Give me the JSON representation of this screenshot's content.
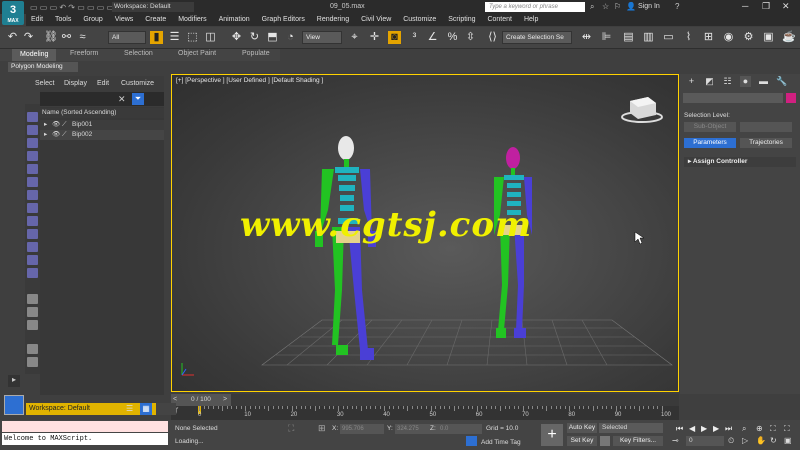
{
  "app": {
    "title": "09_05.max",
    "workspace": "Workspace: Default",
    "search_placeholder": "Type a keyword or phrase",
    "signin": "Sign In"
  },
  "menu": [
    "Edit",
    "Tools",
    "Group",
    "Views",
    "Create",
    "Modifiers",
    "Animation",
    "Graph Editors",
    "Rendering",
    "Civil View",
    "Customize",
    "Scripting",
    "Content",
    "Help"
  ],
  "toolbar": {
    "filter_value": "All",
    "ref_coord": "View",
    "selection_set": "Create Selection Se"
  },
  "ribbon": {
    "tabs": [
      "Modeling",
      "Freeform",
      "Selection",
      "Object Paint",
      "Populate"
    ],
    "active": "Modeling",
    "panel": "Polygon Modeling"
  },
  "scene_explorer": {
    "menu": [
      "Select",
      "Display",
      "Edit",
      "Customize"
    ],
    "header": "Name (Sorted Ascending)",
    "items": [
      "Bip001",
      "Bip002"
    ]
  },
  "viewport": {
    "label": "[+] [Perspective ] [User Defined ] [Default Shading ]"
  },
  "watermark": "www.cgtsj.com",
  "command_panel": {
    "selection_level_label": "Selection Level:",
    "sub_object": "Sub-Object",
    "tab_parameters": "Parameters",
    "tab_trajectories": "Trajectories",
    "rollout": "Assign Controller"
  },
  "timeline": {
    "frame": "0 / 100",
    "ticks": [
      "0",
      "10",
      "20",
      "30",
      "40",
      "50",
      "60",
      "70",
      "80",
      "90",
      "100"
    ]
  },
  "status": {
    "selection": "None Selected",
    "loading": "Loading...",
    "x_label": "X:",
    "x_value": "995.706",
    "y_label": "Y:",
    "y_value": "324.275",
    "z_label": "Z:",
    "z_value": "0.0",
    "grid": "Grid = 10.0",
    "add_time_tag": "Add Time Tag",
    "auto_key": "Auto Key",
    "set_key": "Set Key",
    "key_mode": "Selected",
    "key_filters": "Key Filters...",
    "frame_field": "0"
  },
  "maxscript": {
    "text": "Welcome to MAXScript."
  },
  "workspace_bottom": "Workspace: Default",
  "colors": {
    "accent": "#2d6fd2",
    "viewport_border": "#ffd200",
    "biped_green": "#22c322",
    "biped_blue": "#4a3fd6",
    "biped_cyan": "#1fb3c0",
    "watermark": "#f0f000"
  }
}
